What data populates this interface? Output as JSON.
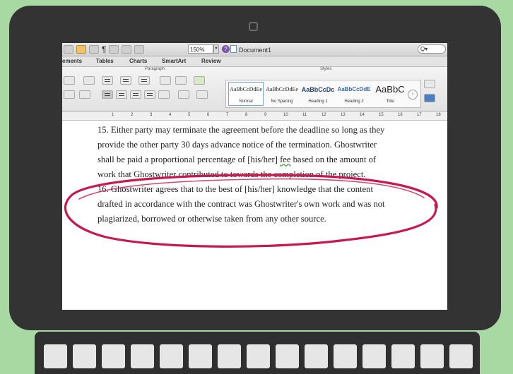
{
  "window": {
    "title": "Document1",
    "zoom": "150%",
    "search_placeholder": "Q▾"
  },
  "toolbar": {
    "pilcrow": "¶",
    "help": "?"
  },
  "ribbon_tabs": [
    "ements",
    "Tables",
    "Charts",
    "SmartArt",
    "Review"
  ],
  "ribbon": {
    "paragraph_group_label": "Paragraph",
    "styles_group_label": "Styles",
    "styles": [
      {
        "sample": "AaBbCcDdEe",
        "name": "Normal"
      },
      {
        "sample": "AaBbCcDdEe",
        "name": "No Spacing"
      },
      {
        "sample": "AaBbCcDc",
        "name": "Heading 1"
      },
      {
        "sample": "AaBbCcDdE",
        "name": "Heading 2"
      },
      {
        "sample": "AaBbC",
        "name": "Title"
      }
    ]
  },
  "ruler": {
    "numbers": [
      "1",
      "2",
      "3",
      "4",
      "5",
      "6",
      "7",
      "8",
      "9",
      "10",
      "11",
      "12",
      "13",
      "14",
      "15",
      "16",
      "17",
      "18"
    ]
  },
  "document": {
    "para15": [
      "15. Either party may terminate the agreement before the deadline so long as they",
      "provide the other party 30 days advance notice of the termination. Ghostwriter",
      "shall be paid a proportional percentage of [his/her] ",
      "fee",
      " based on the amount of",
      "work that Ghostwriter contributed to towards the completion of the project."
    ],
    "para16": [
      "16. Ghostwriter agrees that to the best of [his/her] knowledge that the content",
      "drafted in accordance with the contract was Ghostwriter's own work and was not",
      "plagiarized, borrowed or otherwise taken from any other source."
    ]
  },
  "colors": {
    "highlight_ellipse": "#c8194f",
    "bezel": "#333333",
    "background": "#a9d9a3"
  }
}
